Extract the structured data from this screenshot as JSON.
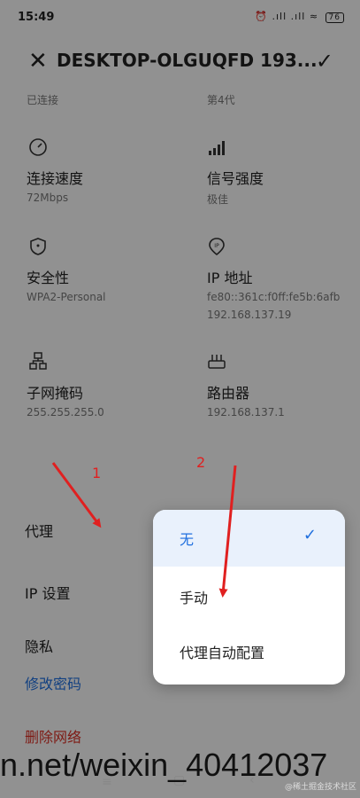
{
  "status_bar": {
    "time": "15:49",
    "icons_text": "⏰ .ıll .ıll",
    "battery": "76"
  },
  "header": {
    "title": "DESKTOP-OLGUQFD 193..."
  },
  "top_labels": {
    "connected": "已连接",
    "generation": "第4代"
  },
  "info": {
    "speed_label": "连接速度",
    "speed_value": "72Mbps",
    "signal_label": "信号强度",
    "signal_value": "极佳",
    "security_label": "安全性",
    "security_value": "WPA2-Personal",
    "ip_label": "IP 地址",
    "ip_value_v6": "fe80::361c:f0ff:fe5b:6afb",
    "ip_value_v4": "192.168.137.19",
    "subnet_label": "子网掩码",
    "subnet_value": "255.255.255.0",
    "router_label": "路由器",
    "router_value": "192.168.137.1"
  },
  "menu": {
    "proxy": "代理",
    "ip_settings": "IP 设置",
    "privacy": "隐私",
    "change_password": "修改密码",
    "delete_network": "删除网络"
  },
  "popup": {
    "options": [
      "无",
      "手动",
      "代理自动配置"
    ],
    "selected_index": 0
  },
  "annotations": {
    "arrow1": "1",
    "arrow2": "2"
  },
  "watermark": {
    "url_text": "n.net/weixin_40412037",
    "corner": "@稀土掘金技术社区"
  },
  "colors": {
    "accent_blue": "#1f6fde",
    "danger_red": "#d93025",
    "annotation_red": "#e02020"
  }
}
